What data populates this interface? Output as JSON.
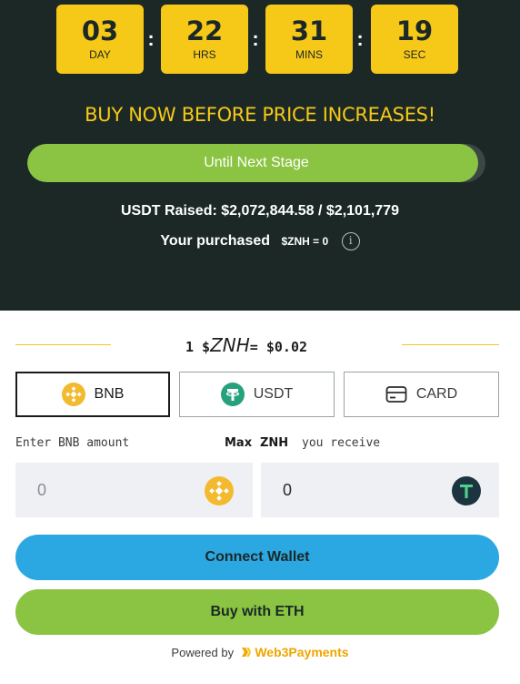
{
  "countdown": [
    {
      "value": "03",
      "unit": "DAY"
    },
    {
      "value": "22",
      "unit": "HRS"
    },
    {
      "value": "31",
      "unit": "MINS"
    },
    {
      "value": "19",
      "unit": "SEC"
    }
  ],
  "colon": ":",
  "headline": "BUY NOW BEFORE PRICE INCREASES!",
  "progress": {
    "label": "Until Next Stage",
    "fraction": 0.985
  },
  "raised": "USDT Raised: $2,072,844.58 / $2,101,779",
  "purchased": {
    "label": "Your purchased",
    "token_value": "$ZNH = 0",
    "info_icon": "info-icon"
  },
  "rate": {
    "prefix": "1 $",
    "symbol": "ZNH",
    "suffix": "= $0.02"
  },
  "tabs": [
    {
      "label": "BNB",
      "icon": "bnb-icon",
      "active": true
    },
    {
      "label": "USDT",
      "icon": "tether-icon",
      "active": false
    },
    {
      "label": "CARD",
      "icon": "card-icon",
      "active": false
    }
  ],
  "inputs": {
    "pay_label": "Enter BNB amount",
    "max_label": "Max",
    "receive_token": "ZNH",
    "receive_label": "you receive",
    "pay_value": "0",
    "receive_value": "0"
  },
  "buttons": {
    "connect": "Connect Wallet",
    "buy": "Buy with ETH"
  },
  "footer": {
    "prefix": "Powered by",
    "brand": "Web3Payments",
    "brand_icon": "web3payments-logo-icon"
  },
  "colors": {
    "accent_yellow": "#f6c818",
    "green": "#8bc442",
    "blue": "#2ba7e1",
    "dark_bg": "#1b2826"
  }
}
